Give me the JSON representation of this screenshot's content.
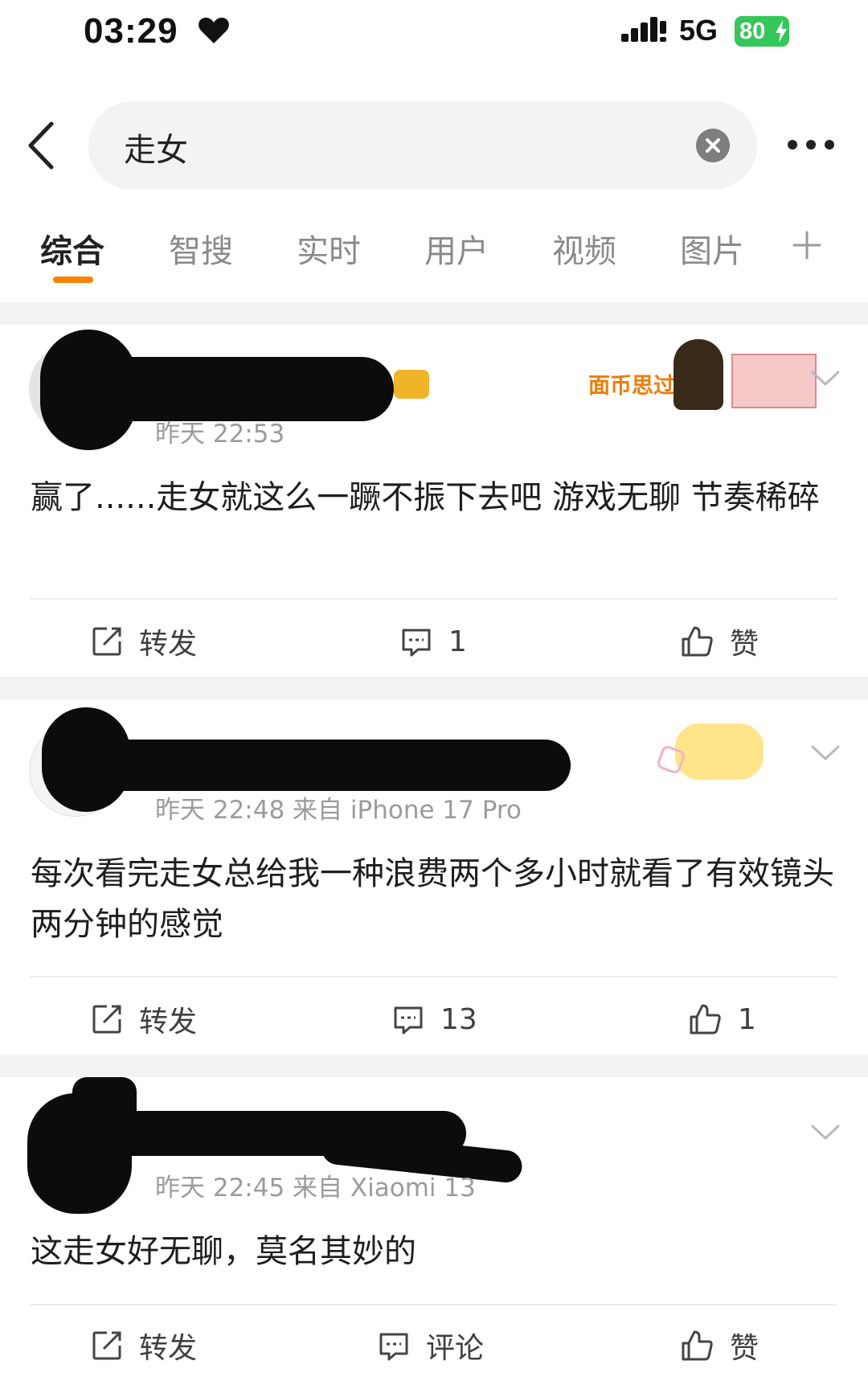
{
  "status_bar": {
    "time": "03:29",
    "network": "5G",
    "battery": "80"
  },
  "search": {
    "query": "走女"
  },
  "tabs": [
    {
      "label": "综合",
      "active": true
    },
    {
      "label": "智搜"
    },
    {
      "label": "实时"
    },
    {
      "label": "用户"
    },
    {
      "label": "视频"
    },
    {
      "label": "图片"
    }
  ],
  "badges": {
    "post1_banner": "面币思过"
  },
  "posts": [
    {
      "meta": "昨天 22:53",
      "text": "赢了......走女就这么一蹶不振下去吧 游戏无聊 节奏稀碎",
      "actions": {
        "repost": "转发",
        "comments": "1",
        "likes": "赞"
      }
    },
    {
      "meta": "昨天 22:48  来自 iPhone 17 Pro",
      "text": "每次看完走女总给我一种浪费两个多小时就看了有效镜头两分钟的感觉",
      "actions": {
        "repost": "转发",
        "comments": "13",
        "likes": "1"
      }
    },
    {
      "meta": "昨天 22:45  来自 Xiaomi 13",
      "text": "这走女好无聊，莫名其妙的",
      "actions": {
        "repost": "转发",
        "comments": "评论",
        "likes": "赞"
      }
    }
  ],
  "colors": {
    "accent": "#ff8200",
    "battery": "#34c759",
    "muted_text": "#9b9b9b",
    "feed_gap": "#f2f2f2"
  },
  "icons": [
    "heart-icon",
    "signal-icon",
    "back-icon",
    "clear-icon",
    "more-icon",
    "plus-icon",
    "chevron-down-icon",
    "repost-icon",
    "comment-icon",
    "like-icon"
  ]
}
